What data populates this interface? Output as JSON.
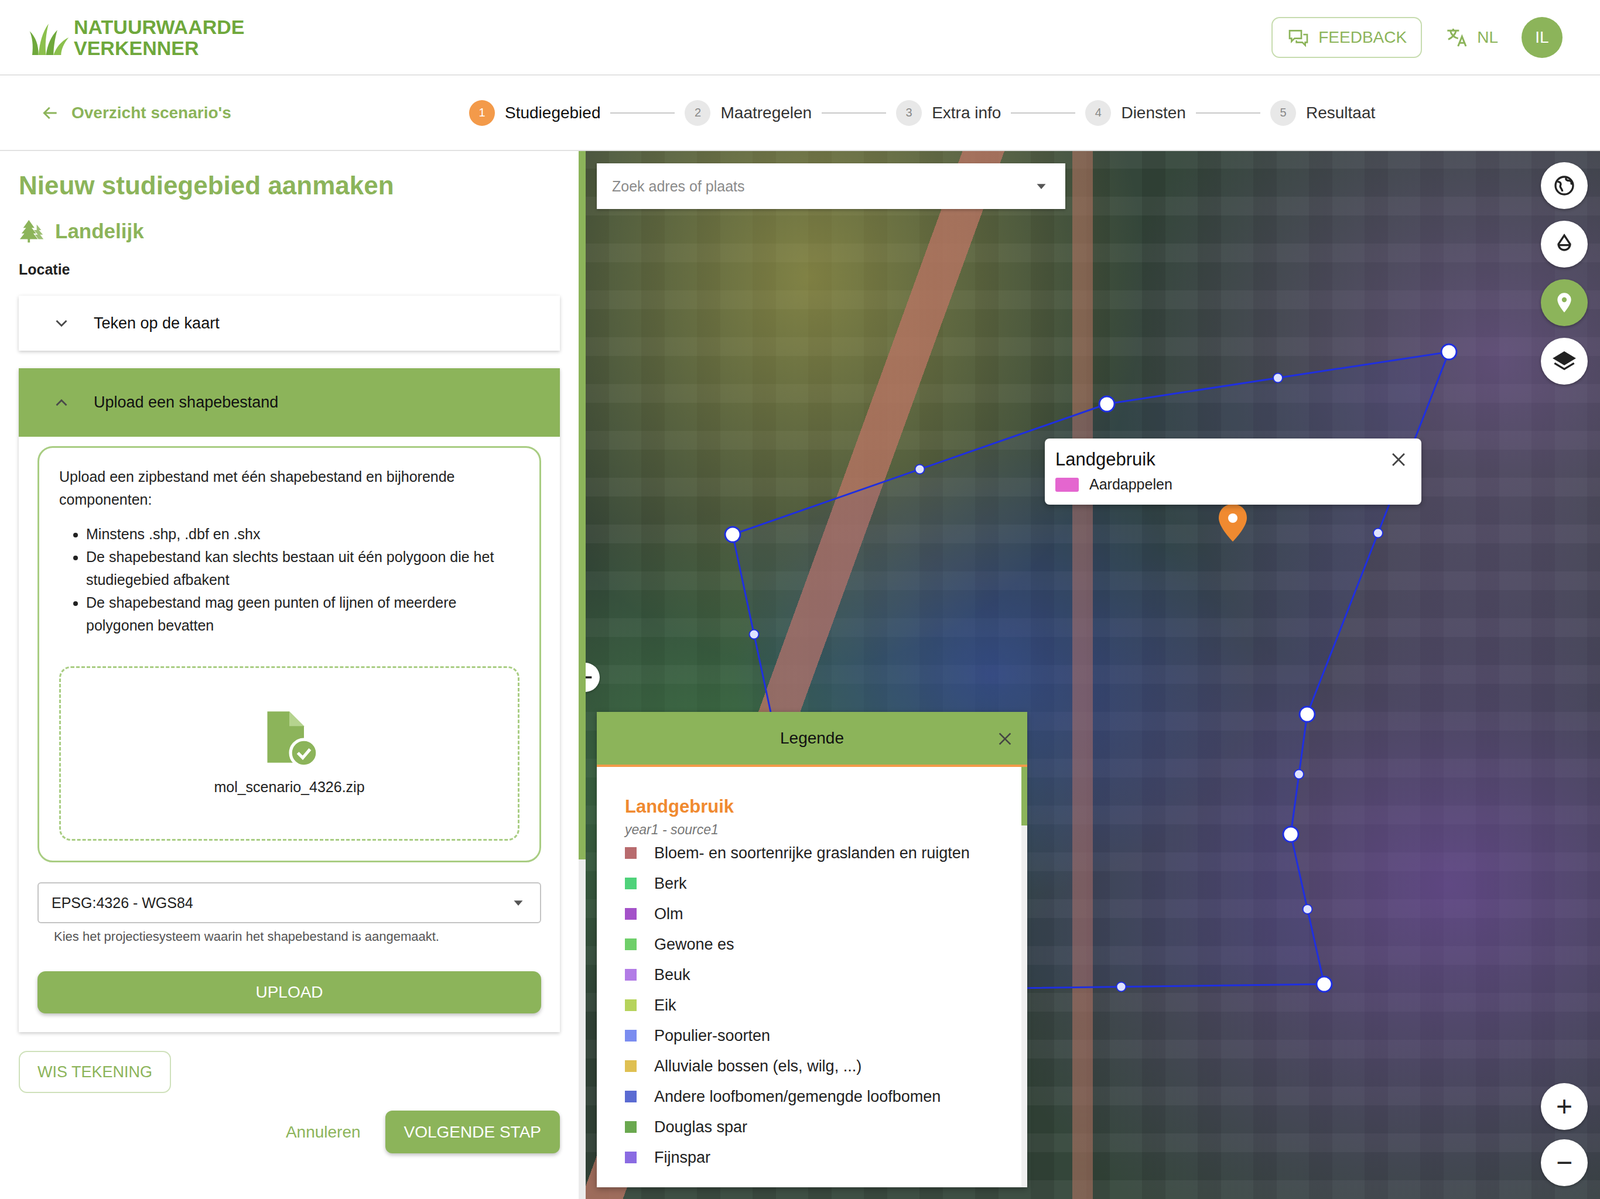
{
  "logo": {
    "line1": "NATUURWAARDE",
    "line2": "VERKENNER"
  },
  "header": {
    "feedback": "FEEDBACK",
    "language": "NL",
    "avatar": "IL"
  },
  "back_link": "Overzicht scenario's",
  "steps": [
    {
      "number": "1",
      "label": "Studiegebied",
      "selected": true
    },
    {
      "number": "2",
      "label": "Maatregelen",
      "selected": false
    },
    {
      "number": "3",
      "label": "Extra info",
      "selected": false
    },
    {
      "number": "4",
      "label": "Diensten",
      "selected": false
    },
    {
      "number": "5",
      "label": "Resultaat",
      "selected": false
    }
  ],
  "panel": {
    "title": "Nieuw studiegebied aanmaken",
    "area_type": "Landelijk",
    "location_label": "Locatie",
    "sections": [
      {
        "label": "Teken op de kaart",
        "expanded": false
      },
      {
        "label": "Upload een shapebestand",
        "expanded": true
      }
    ],
    "upload": {
      "intro": "Upload een zipbestand met één shapebestand en bijhorende componenten:",
      "rules": [
        "Minstens .shp, .dbf en .shx",
        "De shapebestand kan slechts bestaan uit één polygoon die het studiegebied afbakent",
        "De shapebestand mag geen punten of lijnen of meerdere polygonen bevatten"
      ],
      "file_name": "mol_scenario_4326.zip",
      "projection": "EPSG:4326 - WGS84",
      "projection_help": "Kies het projectiesysteem waarin het shapebestand is aangemaakt.",
      "button": "UPLOAD"
    },
    "clear_button": "WIS TEKENING",
    "cancel": "Annuleren",
    "next": "VOLGENDE STAP"
  },
  "map": {
    "search_placeholder": "Zoek adres of plaats",
    "controls": [
      {
        "kind": "globe",
        "selected": false
      },
      {
        "kind": "water",
        "selected": false
      },
      {
        "kind": "pin",
        "selected": true
      },
      {
        "kind": "layers",
        "selected": false
      }
    ],
    "zoom": {
      "in": "+",
      "out": "−"
    },
    "popup": {
      "title": "Landgebruik",
      "item": "Aardappelen",
      "color": "#e466cf"
    },
    "legend": {
      "title": "Legende",
      "layer": "Landgebruik",
      "subtitle": "year1 - source1",
      "items": [
        {
          "label": "Bloem- en soortenrijke graslanden en ruigten",
          "color": "#b86b6e"
        },
        {
          "label": "Berk",
          "color": "#4fd27a"
        },
        {
          "label": "Olm",
          "color": "#a452c9"
        },
        {
          "label": "Gewone es",
          "color": "#6fcf6a"
        },
        {
          "label": "Beuk",
          "color": "#b27ce6"
        },
        {
          "label": "Eik",
          "color": "#b6d35c"
        },
        {
          "label": "Populier-soorten",
          "color": "#7b8df0"
        },
        {
          "label": "Alluviale bossen (els, wilg, ...)",
          "color": "#dfc052"
        },
        {
          "label": "Andere loofbomen/gemengde loofbomen",
          "color": "#5b6bd2"
        },
        {
          "label": "Douglas spar",
          "color": "#6aa84f"
        },
        {
          "label": "Fijnspar",
          "color": "#8a6be2"
        }
      ]
    }
  }
}
